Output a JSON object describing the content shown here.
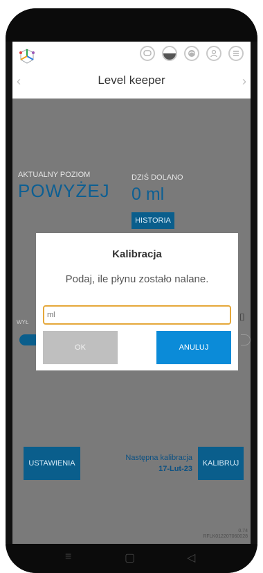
{
  "app": {
    "title": "Level keeper",
    "logo_icon": "cube-logo-icon",
    "header_icons": [
      "chat-icon",
      "level-gauge-icon",
      "globe-icon",
      "user-icon",
      "menu-icon"
    ],
    "nav_left": "‹",
    "nav_right": "›"
  },
  "main": {
    "level_label": "AKTUALNY POZIOM",
    "level_value": "POWYŻEJ",
    "today_label": "DZIŚ DOLANO",
    "today_value": "0 ml",
    "history_button": "HISTORIA",
    "toggle_label_partial": "WYŁ",
    "settings_button": "USTAWIENIA",
    "next_calibration_label": "Następna kalibracja",
    "next_calibration_date": "17-Lut-23",
    "calibrate_button": "KALIBRUJ",
    "version_number": "0.74",
    "device_id": "RFLK012207060028"
  },
  "modal": {
    "title": "Kalibracja",
    "message": "Podaj, ile płynu zostało nalane.",
    "input_placeholder": "ml",
    "input_value": "",
    "ok_button": "OK",
    "cancel_button": "ANULUJ"
  },
  "android_nav": {
    "menu_icon": "≡",
    "home_icon": "▢",
    "back_icon": "◁"
  },
  "colors": {
    "brand_dark_blue": "#0a5e8c",
    "accent_blue": "#0b8bd8",
    "input_focus": "#e5a83a",
    "overlay_gray": "#7a7a7a"
  }
}
